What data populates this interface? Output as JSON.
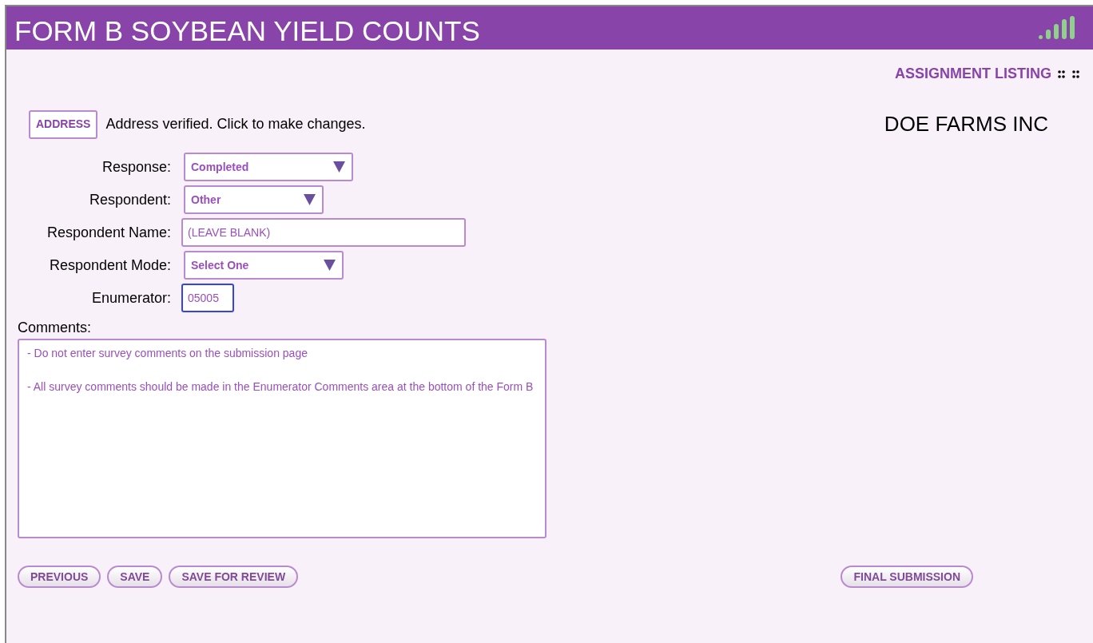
{
  "header": {
    "title": "FORM B SOYBEAN YIELD COUNTS"
  },
  "top_link": "ASSIGNMENT LISTING",
  "address": {
    "button": "ADDRESS",
    "status": "Address verified. Click to make changes."
  },
  "farm_name": "DOE FARMS INC",
  "fields": [
    {
      "label": "Response:",
      "kind": "select",
      "value": "Completed",
      "focused": false
    },
    {
      "label": "Respondent:",
      "kind": "select",
      "value": "Other",
      "focused": false
    },
    {
      "label": "Respondent Name:",
      "kind": "text",
      "value": "(LEAVE BLANK)",
      "focused": false
    },
    {
      "label": "Respondent Mode:",
      "kind": "select",
      "value": "Select One",
      "focused": false
    },
    {
      "label": "Enumerator:",
      "kind": "text",
      "value": "05005",
      "focused": true
    }
  ],
  "comments": {
    "label": "Comments:",
    "value": "- Do not enter survey comments on the submission page\n\n- All survey comments should be made in the Enumerator Comments area at the bottom of the Form B"
  },
  "buttons": [
    "PREVIOUS",
    "SAVE",
    "SAVE FOR REVIEW"
  ],
  "final_button": "FINAL SUBMISSION"
}
